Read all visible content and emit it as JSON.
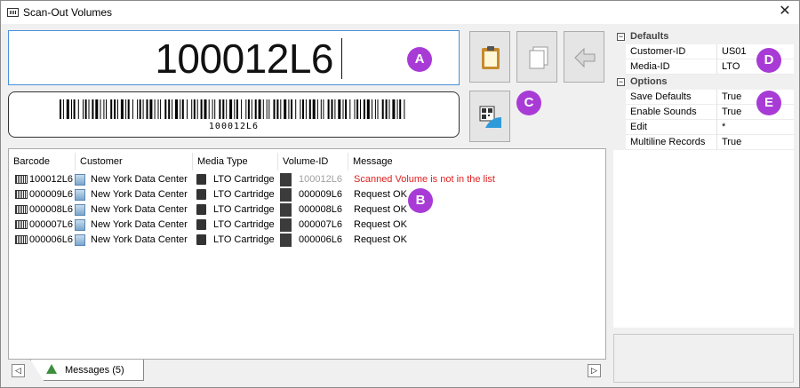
{
  "window": {
    "title": "Scan-Out Volumes",
    "close_glyph": "✕"
  },
  "scan": {
    "value": "100012L6"
  },
  "barcode": {
    "caption": "100012L6"
  },
  "badges": {
    "a": "A",
    "b": "B",
    "c": "C",
    "d": "D",
    "e": "E"
  },
  "accent_color": "#a83bd6",
  "error_color": "#e02020",
  "toolbar": {
    "paste_icon": "clipboard-paste-icon",
    "copy_icon": "copy-pages-icon",
    "back_icon": "arrow-back-icon",
    "qr_icon": "qr-scan-icon"
  },
  "list": {
    "columns": [
      "Barcode",
      "Customer",
      "Media Type",
      "Volume-ID",
      "Message"
    ],
    "rows": [
      {
        "barcode": "100012L6",
        "customer": "New York Data Center",
        "media": "LTO Cartridge",
        "volume": "100012L6",
        "message": "Scanned Volume is not in the list",
        "status": "error"
      },
      {
        "barcode": "000009L6",
        "customer": "New York Data Center",
        "media": "LTO Cartridge",
        "volume": "000009L6",
        "message": "Request OK",
        "status": "ok"
      },
      {
        "barcode": "000008L6",
        "customer": "New York Data Center",
        "media": "LTO Cartridge",
        "volume": "000008L6",
        "message": "Request OK",
        "status": "ok"
      },
      {
        "barcode": "000007L6",
        "customer": "New York Data Center",
        "media": "LTO Cartridge",
        "volume": "000007L6",
        "message": "Request OK",
        "status": "ok"
      },
      {
        "barcode": "000006L6",
        "customer": "New York Data Center",
        "media": "LTO Cartridge",
        "volume": "000006L6",
        "message": "Request OK",
        "status": "ok"
      }
    ]
  },
  "tabs": {
    "messages_label": "Messages (5)",
    "scroll_left": "◁",
    "scroll_right": "▷"
  },
  "properties": {
    "defaults_label": "Defaults",
    "options_label": "Options",
    "collapse_glyph": "−",
    "defaults": [
      {
        "name": "Customer-ID",
        "value": "US01"
      },
      {
        "name": "Media-ID",
        "value": "LTO"
      }
    ],
    "options": [
      {
        "name": "Save Defaults",
        "value": "True"
      },
      {
        "name": "Enable Sounds",
        "value": "True"
      },
      {
        "name": "Edit",
        "value": "*"
      },
      {
        "name": "Multiline Records",
        "value": "True"
      }
    ]
  }
}
